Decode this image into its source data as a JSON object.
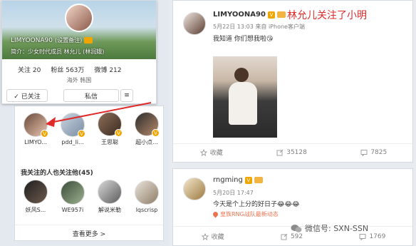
{
  "left_profile": {
    "username": "LIMYOONA90",
    "username_suffix": "(设置备注)",
    "bio": "简介：少女时代成员 林允儿 (林润娥)",
    "stats": [
      {
        "label": "关注",
        "value": "20"
      },
      {
        "label": "粉丝",
        "value": "563万"
      },
      {
        "label": "微博",
        "value": "212"
      }
    ],
    "location": "海外 韩国",
    "followed_label": "✓ 已关注",
    "message_label": "私信",
    "menu_label": "≡"
  },
  "following_list": [
    {
      "name": "LIMYO..."
    },
    {
      "name": "pdd_li..."
    },
    {
      "name": "王思聪"
    },
    {
      "name": "超小点..."
    }
  ],
  "mutual_section": {
    "title": "我关注的人也关注他(45)",
    "users": [
      {
        "name": "妖风S..."
      },
      {
        "name": "WE957i"
      },
      {
        "name": "解说米勒"
      },
      {
        "name": "lqscrisp"
      }
    ],
    "more_label": "查看更多 >"
  },
  "post1": {
    "username": "LIMYOONA90",
    "headline": "林允儿关注了小明",
    "meta": "5月22日 13:03 来自 iPhone客户端",
    "text": "我知道 你们想我啦😘",
    "actions": [
      {
        "icon": "bookmark-icon",
        "label": "收藏"
      },
      {
        "icon": "share-icon",
        "label": "35128"
      },
      {
        "icon": "comment-icon",
        "label": "7825"
      }
    ]
  },
  "post2": {
    "username": "rngming",
    "meta": "5月20日 17:47",
    "text": "今天是个上分的好日子😂😂😂",
    "source": "皇族RNG战队最新动态",
    "actions": [
      {
        "icon": "bookmark-icon",
        "label": "收藏"
      },
      {
        "icon": "share-icon",
        "label": "592"
      },
      {
        "icon": "comment-icon",
        "label": "1769"
      }
    ]
  },
  "watermark": {
    "text": "微信号: SXN-SSN"
  },
  "colors": {
    "accent_red": "#e02a2a",
    "weibo_orange": "#eb7350",
    "vip_gold": "#f0a500"
  }
}
